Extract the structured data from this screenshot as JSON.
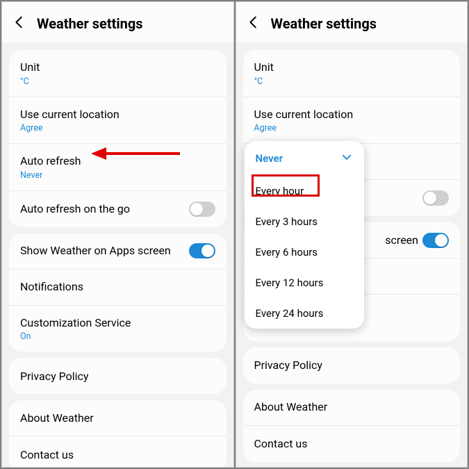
{
  "header": {
    "title": "Weather settings"
  },
  "rows": {
    "unit": {
      "label": "Unit",
      "value": "°C"
    },
    "location": {
      "label": "Use current location",
      "value": "Agree"
    },
    "autorefresh": {
      "label": "Auto refresh",
      "value": "Never"
    },
    "onthego": {
      "label": "Auto refresh on the go"
    },
    "appscreen": {
      "label": "Show Weather on Apps screen"
    },
    "notifications": {
      "label": "Notifications"
    },
    "customization": {
      "label": "Customization Service",
      "value": "On"
    },
    "privacy": {
      "label": "Privacy Policy"
    },
    "about": {
      "label": "About Weather"
    },
    "contact": {
      "label": "Contact us"
    }
  },
  "right": {
    "customization_value": "On",
    "appscreen_suffix": "screen"
  },
  "dropdown": {
    "selected": "Never",
    "items": [
      "Every hour",
      "Every 3 hours",
      "Every 6 hours",
      "Every 12 hours",
      "Every 24 hours"
    ]
  }
}
